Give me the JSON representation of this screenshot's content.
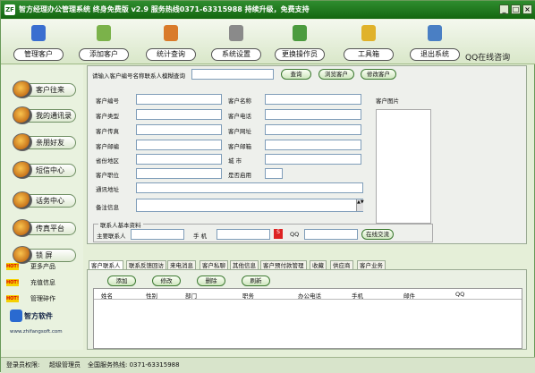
{
  "window": {
    "title": "智方经理办公管理系统  终身免费版 v2.9    服务热线0371-63315988 持续升级，免费支持",
    "app_icon": "ZF"
  },
  "toolbar": {
    "items": [
      {
        "label": "管理客户",
        "icon": "customer-icon"
      },
      {
        "label": "添加客户",
        "icon": "add-customer-icon"
      },
      {
        "label": "统计查询",
        "icon": "statistics-icon"
      },
      {
        "label": "系统设置",
        "icon": "settings-icon"
      },
      {
        "label": "更换操作员",
        "icon": "operator-icon"
      },
      {
        "label": "工具箱",
        "icon": "toolbox-icon"
      },
      {
        "label": "退出系统",
        "icon": "exit-icon"
      }
    ],
    "qq_online": "QQ在线咨询"
  },
  "sidebar": {
    "items": [
      "客户往来",
      "我的通讯录",
      "亲朋好友",
      "短信中心",
      "话务中心",
      "传真平台",
      "锁  屏"
    ],
    "hot_label": "HOT!",
    "hot_links": [
      "更多产品",
      "充值信息",
      "管理碎作"
    ],
    "logo_text": "智方软件",
    "logo_url": "www.zhifangsoft.com"
  },
  "search": {
    "label": "请输入客户编号名称联系人模糊查询",
    "query": "",
    "search_btn": "查询",
    "browse_btn": "浏览客户",
    "modify_btn": "修改客户"
  },
  "form": {
    "left": [
      "客户编号",
      "客户类型",
      "客户传真",
      "客户邮编",
      "省份地区",
      "客户职位",
      "通讯地址",
      "备注信息"
    ],
    "right": [
      "客户名称",
      "客户电话",
      "客户网址",
      "客户邮箱",
      "城    市",
      "是否启用"
    ],
    "photo_label": "客户图片"
  },
  "contact": {
    "group": "联系人基本资料",
    "main_contact": "主要联系人",
    "mobile": "手   机",
    "qq": "QQ",
    "online_btn": "在线交流"
  },
  "tabs": [
    "客户联系人",
    "联系反馈回访",
    "来电消息",
    "客户私聊",
    "其他信息",
    "客户预付款管理",
    "收藏",
    "供应商",
    "客户业务"
  ],
  "grid_buttons": [
    "添加",
    "修改",
    "删除",
    "刷新"
  ],
  "grid_columns": [
    "姓名",
    "性别",
    "部门",
    "职务",
    "办公电话",
    "手机",
    "邮件",
    "QQ"
  ],
  "status": {
    "login": "登录员权限:",
    "role": "超级管理员",
    "hotline": "全国服务热线: 0371-63315988"
  },
  "colors": {
    "title_green": "#1f7a1c",
    "accent": "#3d7a32",
    "hot_yellow": "#f5d000"
  }
}
